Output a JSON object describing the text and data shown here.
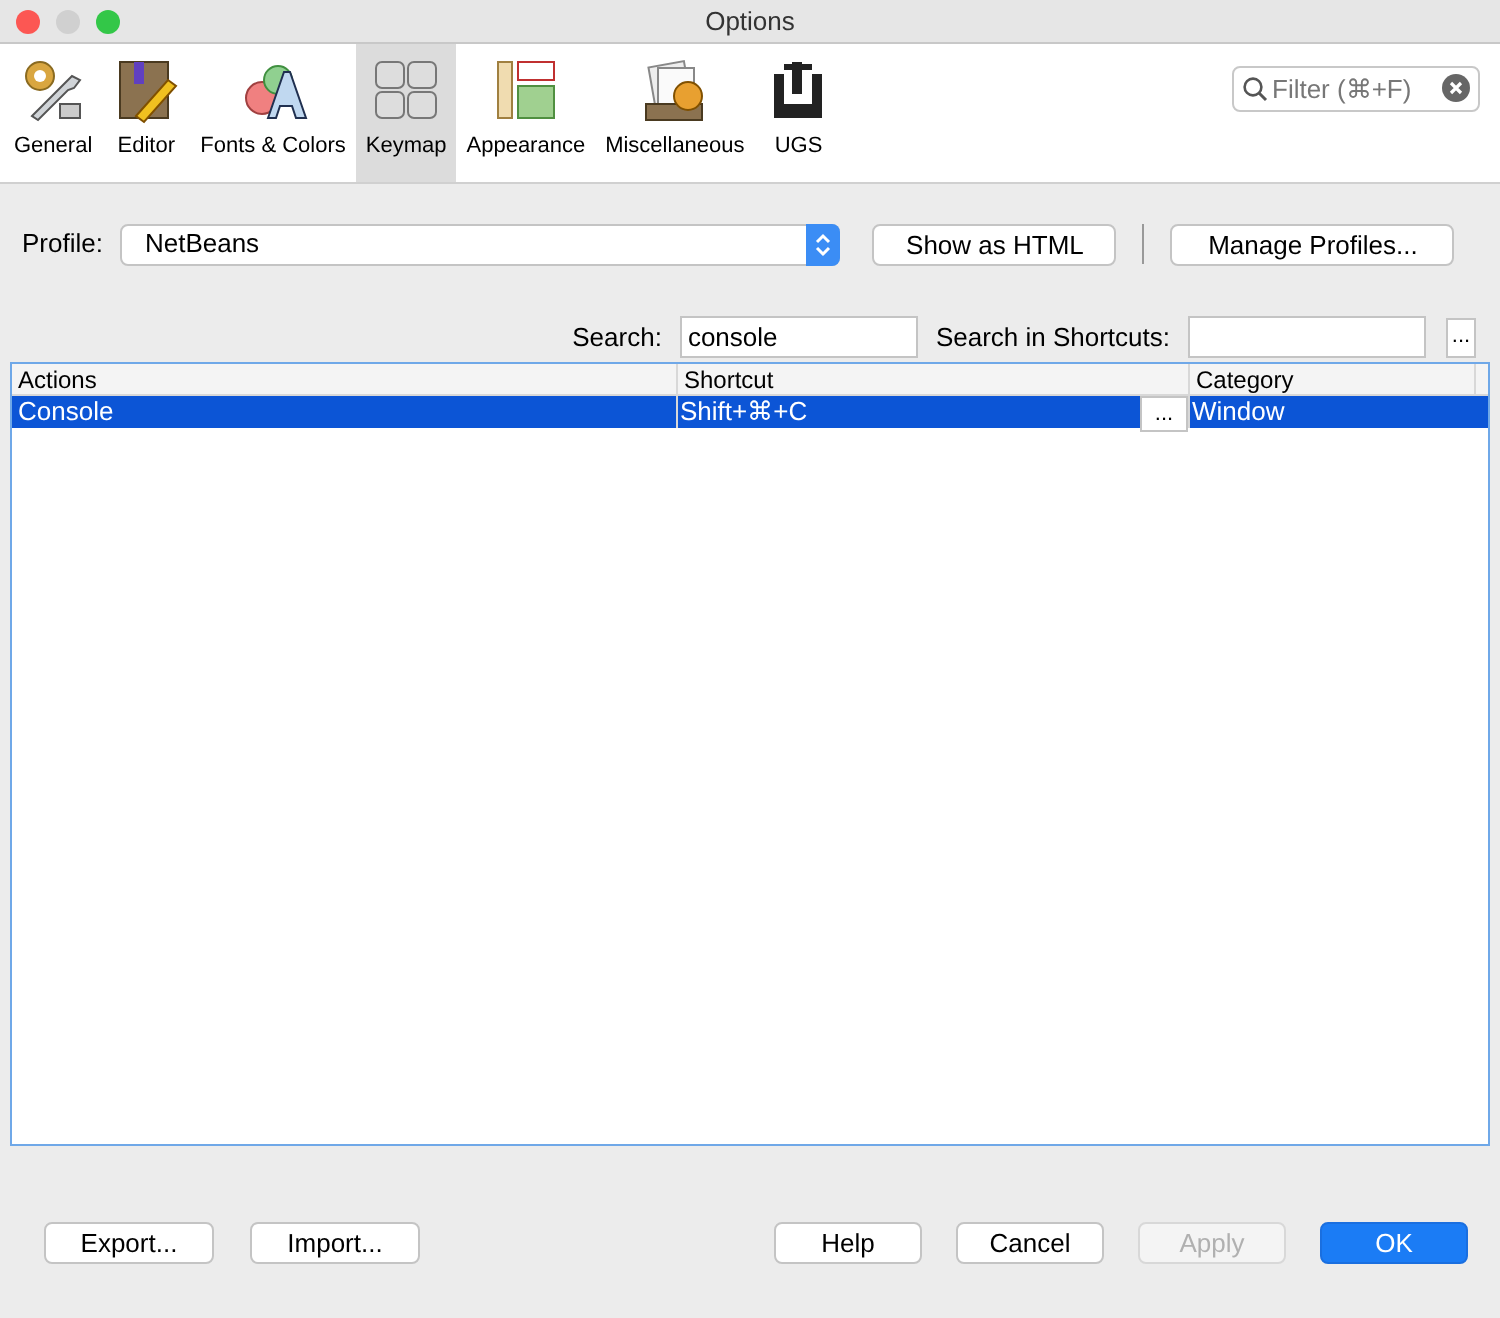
{
  "window": {
    "title": "Options"
  },
  "categories": [
    {
      "label": "General",
      "kind": "general",
      "selected": false
    },
    {
      "label": "Editor",
      "kind": "editor",
      "selected": false
    },
    {
      "label": "Fonts & Colors",
      "kind": "fonts",
      "selected": false
    },
    {
      "label": "Keymap",
      "kind": "keymap",
      "selected": true
    },
    {
      "label": "Appearance",
      "kind": "appearance",
      "selected": false
    },
    {
      "label": "Miscellaneous",
      "kind": "misc",
      "selected": false
    },
    {
      "label": "UGS",
      "kind": "ugs",
      "selected": false
    }
  ],
  "filter": {
    "placeholder": "Filter (⌘+F)"
  },
  "profile": {
    "label": "Profile:",
    "value": "NetBeans"
  },
  "profile_buttons": [
    "Show as HTML",
    "Manage Profiles..."
  ],
  "search": {
    "label": "Search:",
    "value": "console"
  },
  "search_shortcuts": {
    "label": "Search in Shortcuts:",
    "button": "..."
  },
  "table": {
    "columns": [
      "Actions",
      "Shortcut",
      "Category"
    ],
    "rows": [
      {
        "action": "Console",
        "shortcut": "Shift+⌘+C",
        "edit_button": "...",
        "category": "Window",
        "selected": true
      }
    ]
  },
  "footer_left": [
    {
      "label": "Export...",
      "disabled": false
    },
    {
      "label": "Import...",
      "disabled": false
    }
  ],
  "footer_right": [
    {
      "label": "Help",
      "disabled": false,
      "default": false
    },
    {
      "label": "Cancel",
      "disabled": false,
      "default": false
    },
    {
      "label": "Apply",
      "disabled": true,
      "default": false
    },
    {
      "label": "OK",
      "disabled": false,
      "default": true
    }
  ]
}
